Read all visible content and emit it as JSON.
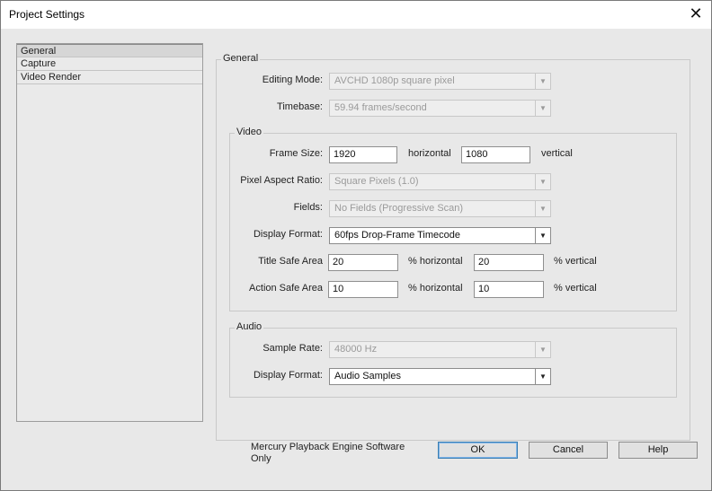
{
  "window": {
    "title": "Project Settings",
    "close_glyph": "✕"
  },
  "nav": {
    "items": [
      {
        "label": "General"
      },
      {
        "label": "Capture"
      },
      {
        "label": "Video Render"
      }
    ]
  },
  "general": {
    "group_label": "General",
    "editing_mode": {
      "label": "Editing Mode:",
      "value": "AVCHD 1080p square pixel"
    },
    "timebase": {
      "label": "Timebase:",
      "value": "59.94  frames/second"
    }
  },
  "video": {
    "group_label": "Video",
    "frame_size": {
      "label": "Frame Size:",
      "horizontal": "1920",
      "horizontal_label": "horizontal",
      "vertical": "1080",
      "vertical_label": "vertical"
    },
    "pixel_aspect": {
      "label": "Pixel Aspect Ratio:",
      "value": "Square Pixels (1.0)"
    },
    "fields": {
      "label": "Fields:",
      "value": "No Fields (Progressive Scan)"
    },
    "display_format": {
      "label": "Display Format:",
      "value": "60fps Drop-Frame Timecode"
    },
    "title_safe": {
      "label": "Title Safe Area",
      "horizontal": "20",
      "horizontal_label": "% horizontal",
      "vertical": "20",
      "vertical_label": "% vertical"
    },
    "action_safe": {
      "label": "Action Safe Area",
      "horizontal": "10",
      "horizontal_label": "% horizontal",
      "vertical": "10",
      "vertical_label": "% vertical"
    }
  },
  "audio": {
    "group_label": "Audio",
    "sample_rate": {
      "label": "Sample Rate:",
      "value": "48000 Hz"
    },
    "display_format": {
      "label": "Display Format:",
      "value": "Audio Samples"
    }
  },
  "footer": {
    "engine_text": "Mercury Playback Engine Software Only",
    "ok_label": "OK",
    "cancel_label": "Cancel",
    "help_label": "Help"
  },
  "icons": {
    "dropdown_arrow": "▼"
  }
}
